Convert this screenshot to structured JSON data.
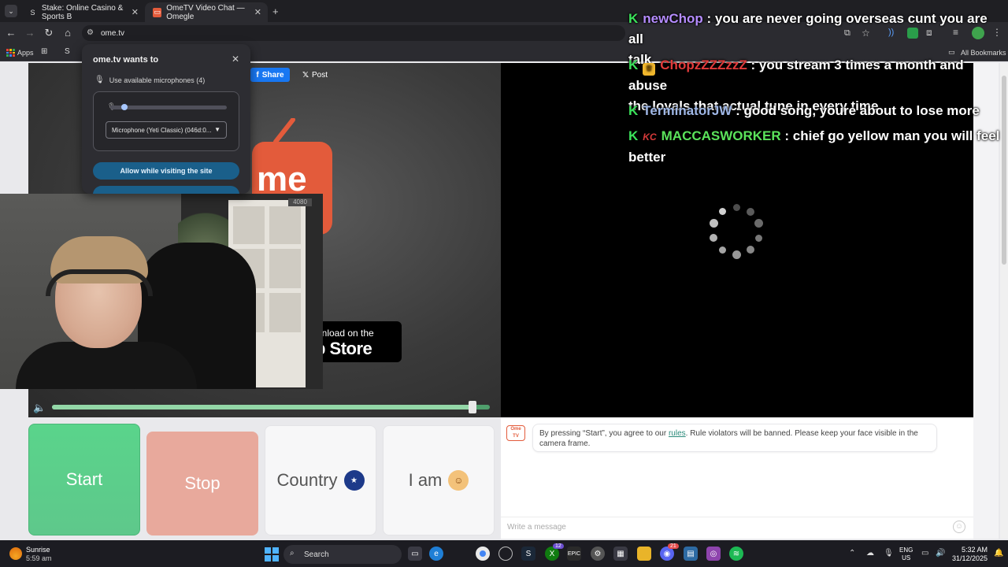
{
  "browser": {
    "tabs": [
      {
        "title": "Stake: Online Casino & Sports B",
        "icon": "stake-icon"
      },
      {
        "title": "OmeTV Video Chat — Omegle",
        "icon": "ometv-icon"
      }
    ],
    "url": "ome.tv",
    "bookmarks": {
      "apps": "Apps",
      "all": "All Bookmarks"
    }
  },
  "permission": {
    "title": "ome.tv wants to",
    "mic_label": "Use available microphones (4)",
    "device": "Microphone (Yeti Classic) (046d:0...",
    "allow_label": "Allow while visiting the site"
  },
  "left_video": {
    "share": "Share",
    "post": "Post",
    "logo_text": "me",
    "app_line1": "wnload on the",
    "app_line2": "p Store",
    "gpu_tag": "4080"
  },
  "volume": {
    "level": 0.96
  },
  "buttons": {
    "start": "Start",
    "stop": "Stop",
    "country": "Country",
    "iam": "I am"
  },
  "chat": {
    "logo_l1": "Ome",
    "logo_l2": "TV",
    "rules_pre": "By pressing “Start”, you agree to our ",
    "rules_link": "rules",
    "rules_post": ". Rule violators will be banned. Please keep your face visible in the camera frame.",
    "input_placeholder": "Write a message"
  },
  "stream_chat": [
    {
      "user": "newChop",
      "color": "#b58cff",
      "text": ": you are never going overseas cunt you are all",
      "cont": "talk",
      "badge": "none"
    },
    {
      "user": "ChopzZZZzzZ",
      "color": "#e23b3b",
      "text": ": you stream 3 times a month and abuse",
      "cont": "the loyals that actual tune in every time",
      "badge": "crown"
    },
    {
      "user": "TerminatorJW",
      "color": "#9fb7e6",
      "text": ": good song, youre about to lose more",
      "cont": "",
      "badge": "none"
    },
    {
      "user": "MACCASWORKER",
      "color": "#5be35b",
      "text": ": chief go yellow man you will feel",
      "cont": "better",
      "badge": "kc"
    }
  ],
  "taskbar": {
    "weather_title": "Sunrise",
    "weather_time": "5:59 am",
    "search": "Search",
    "lang1": "ENG",
    "lang2": "US",
    "time": "5:32 AM",
    "date": "31/12/2025",
    "badge_xbox": "12",
    "badge_discord": "21"
  }
}
